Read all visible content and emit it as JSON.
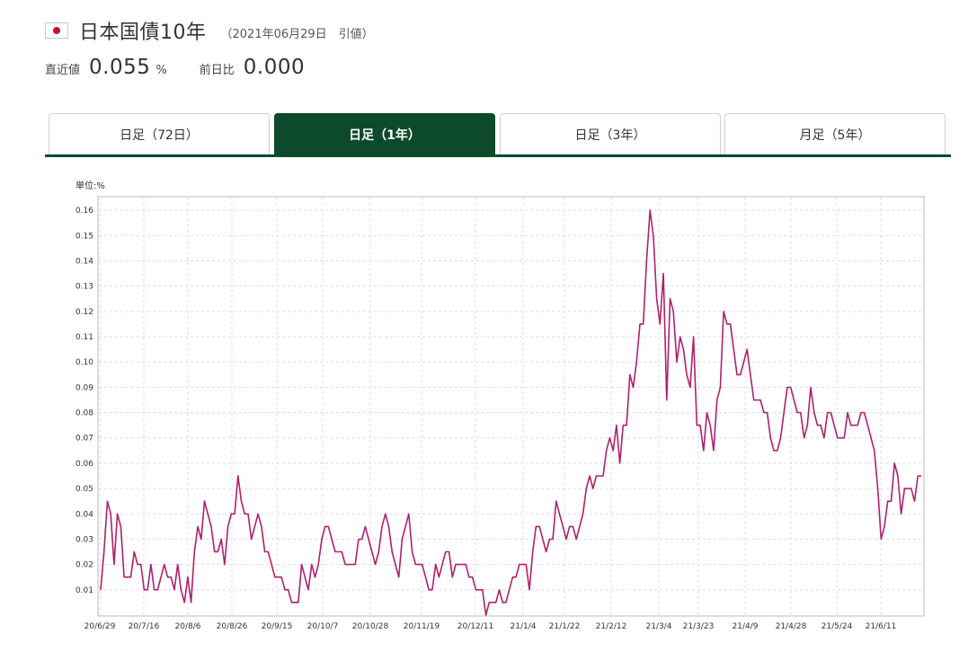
{
  "header": {
    "title": "日本国債10年",
    "subtitle": "（2021年06月29日　引値）",
    "latest_label": "直近値",
    "latest_value": "0.055",
    "latest_unit": "%",
    "change_label": "前日比",
    "change_value": "0.000"
  },
  "colors": {
    "accent": "#0d4a2c",
    "series": "#b0206e",
    "flag_red": "#c8102e"
  },
  "tabs": [
    {
      "label": "日足（72日）",
      "active": false
    },
    {
      "label": "日足（1年）",
      "active": true
    },
    {
      "label": "日足（3年）",
      "active": false
    },
    {
      "label": "月足（5年）",
      "active": false
    }
  ],
  "chart_data": {
    "type": "line",
    "unit_label": "単位:%",
    "ylim": [
      0,
      0.165
    ],
    "yticks": [
      "0.01",
      "0.02",
      "0.03",
      "0.04",
      "0.05",
      "0.06",
      "0.07",
      "0.08",
      "0.09",
      "0.10",
      "0.11",
      "0.12",
      "0.13",
      "0.14",
      "0.15",
      "0.16"
    ],
    "xticks": [
      "20/6/29",
      "20/7/16",
      "20/8/6",
      "20/8/26",
      "20/9/15",
      "20/10/7",
      "20/10/28",
      "20/11/19",
      "20/12/11",
      "21/1/4",
      "21/1/22",
      "21/2/12",
      "21/3/4",
      "21/3/23",
      "21/4/9",
      "21/4/28",
      "21/5/24",
      "21/6/11"
    ],
    "grid": true,
    "series": [
      {
        "values": [
          0.01,
          0.025,
          0.045,
          0.04,
          0.02,
          0.04,
          0.035,
          0.015,
          0.015,
          0.015,
          0.025,
          0.02,
          0.02,
          0.01,
          0.01,
          0.02,
          0.01,
          0.01,
          0.015,
          0.02,
          0.015,
          0.015,
          0.01,
          0.02,
          0.01,
          0.005,
          0.015,
          0.005,
          0.025,
          0.035,
          0.03,
          0.045,
          0.04,
          0.035,
          0.025,
          0.025,
          0.03,
          0.02,
          0.035,
          0.04,
          0.04,
          0.055,
          0.045,
          0.04,
          0.04,
          0.03,
          0.035,
          0.04,
          0.035,
          0.025,
          0.025,
          0.02,
          0.015,
          0.015,
          0.015,
          0.01,
          0.01,
          0.005,
          0.005,
          0.005,
          0.02,
          0.015,
          0.01,
          0.02,
          0.015,
          0.02,
          0.03,
          0.035,
          0.035,
          0.03,
          0.025,
          0.025,
          0.025,
          0.02,
          0.02,
          0.02,
          0.02,
          0.03,
          0.03,
          0.035,
          0.03,
          0.025,
          0.02,
          0.025,
          0.035,
          0.04,
          0.035,
          0.025,
          0.02,
          0.015,
          0.03,
          0.035,
          0.04,
          0.025,
          0.02,
          0.02,
          0.02,
          0.015,
          0.01,
          0.01,
          0.02,
          0.015,
          0.02,
          0.025,
          0.025,
          0.015,
          0.02,
          0.02,
          0.02,
          0.02,
          0.015,
          0.015,
          0.01,
          0.01,
          0.01,
          0.0,
          0.005,
          0.005,
          0.005,
          0.01,
          0.005,
          0.005,
          0.01,
          0.015,
          0.015,
          0.02,
          0.02,
          0.02,
          0.01,
          0.025,
          0.035,
          0.035,
          0.03,
          0.025,
          0.03,
          0.03,
          0.045,
          0.04,
          0.035,
          0.03,
          0.035,
          0.035,
          0.03,
          0.035,
          0.04,
          0.05,
          0.055,
          0.05,
          0.055,
          0.055,
          0.055,
          0.065,
          0.07,
          0.065,
          0.075,
          0.06,
          0.075,
          0.075,
          0.095,
          0.09,
          0.1,
          0.115,
          0.115,
          0.14,
          0.16,
          0.15,
          0.125,
          0.115,
          0.135,
          0.085,
          0.125,
          0.12,
          0.1,
          0.11,
          0.105,
          0.095,
          0.09,
          0.11,
          0.075,
          0.075,
          0.065,
          0.08,
          0.075,
          0.065,
          0.085,
          0.09,
          0.12,
          0.115,
          0.115,
          0.105,
          0.095,
          0.095,
          0.1,
          0.105,
          0.095,
          0.085,
          0.085,
          0.085,
          0.08,
          0.08,
          0.07,
          0.065,
          0.065,
          0.07,
          0.08,
          0.09,
          0.09,
          0.085,
          0.08,
          0.08,
          0.07,
          0.075,
          0.09,
          0.08,
          0.075,
          0.075,
          0.07,
          0.08,
          0.08,
          0.075,
          0.07,
          0.07,
          0.07,
          0.08,
          0.075,
          0.075,
          0.075,
          0.08,
          0.08,
          0.075,
          0.07,
          0.065,
          0.05,
          0.03,
          0.035,
          0.045,
          0.045,
          0.06,
          0.055,
          0.04,
          0.05,
          0.05,
          0.05,
          0.045,
          0.055,
          0.055
        ]
      }
    ]
  }
}
